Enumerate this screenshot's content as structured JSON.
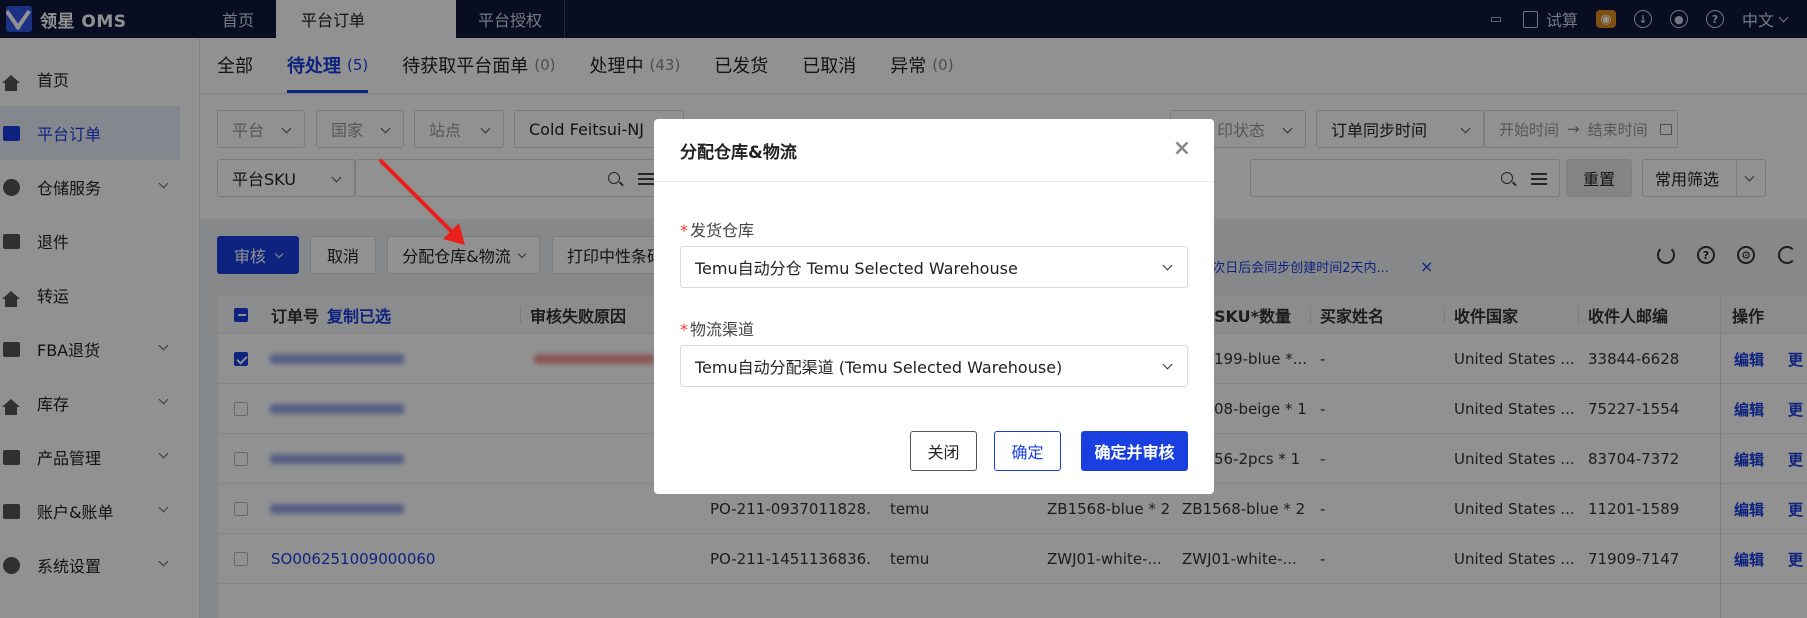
{
  "app": {
    "logo_text": "领星 OMS"
  },
  "top_tabs": [
    {
      "label": "首页"
    },
    {
      "label": "平台订单"
    },
    {
      "label": "平台授权"
    }
  ],
  "top_right": {
    "trial_label": "试算",
    "lang_label": "中文"
  },
  "sidebar": {
    "items": [
      {
        "label": "首页"
      },
      {
        "label": "平台订单"
      },
      {
        "label": "仓储服务"
      },
      {
        "label": "退件"
      },
      {
        "label": "转运"
      },
      {
        "label": "FBA退货"
      },
      {
        "label": "库存"
      },
      {
        "label": "产品管理"
      },
      {
        "label": "账户&账单"
      },
      {
        "label": "系统设置"
      }
    ]
  },
  "status_tabs": [
    {
      "label": "全部",
      "count": ""
    },
    {
      "label": "待处理",
      "count": "(5)"
    },
    {
      "label": "待获取平台面单",
      "count": "(0)"
    },
    {
      "label": "处理中",
      "count": "(43)"
    },
    {
      "label": "已发货",
      "count": ""
    },
    {
      "label": "已取消",
      "count": ""
    },
    {
      "label": "异常",
      "count": "(0)"
    }
  ],
  "filters": {
    "platform": "平台",
    "country": "国家",
    "site": "站点",
    "warehouse": "Cold Feitsui-NJ",
    "print_status_fragment": "印状态",
    "sync_time": "订单同步时间",
    "start_time": "开始时间",
    "end_time": "结束时间",
    "time_arrow": "→",
    "platform_sku": "平台SKU",
    "reset": "重置",
    "common_filter": "常用筛选"
  },
  "actions": {
    "audit": "审核",
    "cancel": "取消",
    "assign": "分配仓库&物流",
    "print_neutral": "打印中性条码",
    "notice": "会同步创建时间5天范围内的订单；次日后会同步创建时间2天内...",
    "notice_close": "×"
  },
  "table": {
    "headers": {
      "order_no": "订单号",
      "copy_selected": "复制已选",
      "audit_fail": "审核失败原因",
      "sku_qty": "SKU*数量",
      "buyer": "买家姓名",
      "country": "收件国家",
      "zip": "收件人邮编",
      "ops": "操作"
    },
    "rows": [
      {
        "order": "",
        "po": "",
        "platform": "",
        "sku": "",
        "sku_qty": "199-blue *...",
        "buyer": "-",
        "country": "United States ...",
        "zip": "33844-6628",
        "edit": "编辑",
        "more": "更"
      },
      {
        "order": "",
        "po": "",
        "platform": "",
        "sku": "",
        "sku_qty": "08-beige * 1",
        "buyer": "-",
        "country": "United States ...",
        "zip": "75227-1554",
        "edit": "编辑",
        "more": "更"
      },
      {
        "order": "",
        "po": "",
        "platform": "",
        "sku": "",
        "sku_qty": "56-2pcs * 1",
        "buyer": "-",
        "country": "United States ...",
        "zip": "83704-7372",
        "edit": "编辑",
        "more": "更"
      },
      {
        "order": "",
        "po": "PO-211-0937011828...",
        "platform": "temu",
        "sku": "ZB1568-blue * 2",
        "sku_qty": "ZB1568-blue * 2",
        "buyer": "-",
        "country": "United States ...",
        "zip": "11201-1589",
        "edit": "编辑",
        "more": "更"
      },
      {
        "order": "SO006251009000060",
        "po": "PO-211-1451136836...",
        "platform": "temu",
        "sku": "ZWJ01-white-...",
        "sku_qty": "ZWJ01-white-...",
        "buyer": "-",
        "country": "United States ...",
        "zip": "71909-7147",
        "edit": "编辑",
        "more": "更"
      }
    ]
  },
  "modal": {
    "title": "分配仓库&物流",
    "close_icon": "×",
    "warehouse_label": "发货仓库",
    "warehouse_value": "Temu自动分仓 Temu Selected Warehouse",
    "channel_label": "物流渠道",
    "channel_value": "Temu自动分配渠道 (Temu Selected Warehouse)",
    "required_mark": "*",
    "btn_close": "关闭",
    "btn_ok": "确定",
    "btn_ok_audit": "确定并审核"
  },
  "colors": {
    "primary": "#1a3fe0",
    "topbar": "#10173a",
    "annotation": "#e8201c"
  }
}
